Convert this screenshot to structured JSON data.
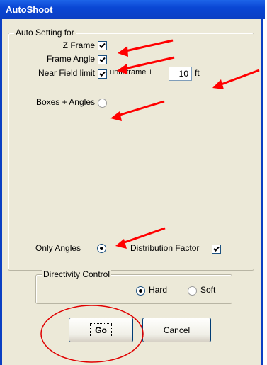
{
  "window": {
    "title": "AutoShoot"
  },
  "auto_setting": {
    "legend": "Auto Setting for",
    "z_frame": {
      "label": "Z Frame",
      "checked": true
    },
    "frame_angle": {
      "label": "Frame Angle",
      "checked": true
    },
    "near_field": {
      "label": "Near Field limit",
      "checked": true,
      "until_label": "until frame +",
      "value": "10",
      "unit": "ft"
    },
    "boxes_angles": {
      "label": "Boxes + Angles",
      "selected": false
    },
    "only_angles": {
      "label": "Only Angles",
      "selected": true
    },
    "distribution_factor": {
      "label": "Distribution Factor",
      "checked": true
    }
  },
  "directivity": {
    "legend": "Directivity Control",
    "hard": {
      "label": "Hard",
      "selected": true
    },
    "soft": {
      "label": "Soft",
      "selected": false
    }
  },
  "buttons": {
    "go": "Go",
    "cancel": "Cancel"
  },
  "annotation_colors": {
    "arrow": "#ff0000",
    "circle": "#e00000"
  }
}
